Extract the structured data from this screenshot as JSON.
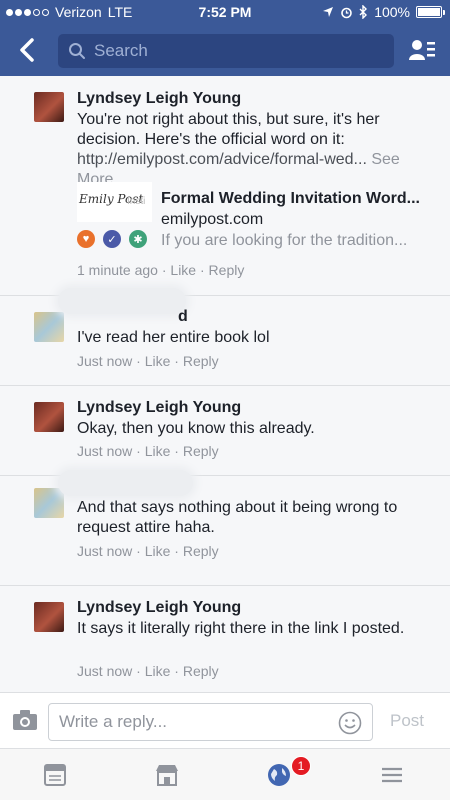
{
  "status_bar": {
    "carrier": "Verizon",
    "network": "LTE",
    "time": "7:52 PM",
    "battery": "100%"
  },
  "nav": {
    "search_placeholder": "Search"
  },
  "comments": [
    {
      "author": "Lyndsey Leigh Young",
      "text_plain": "You're not right about this, but sure, it's her decision. Here's the official word on it: ",
      "link_text": "http://emilypost.com/advice/formal-wed...",
      "see_more": "See More",
      "meta_time": "1 minute ago",
      "like": "Like",
      "reply": "Reply",
      "link_preview": {
        "thumb_script": "Emily Post",
        "thumb_text": "Insti",
        "title": "Formal Wedding Invitation Word...",
        "domain": "emilypost.com",
        "description": "If you are looking for the tradition..."
      }
    },
    {
      "author_visible": "d",
      "text": "I've read her entire book lol",
      "meta_time": "Just now",
      "like": "Like",
      "reply": "Reply"
    },
    {
      "author": "Lyndsey Leigh Young",
      "text": "Okay, then you know this already.",
      "meta_time": "Just now",
      "like": "Like",
      "reply": "Reply"
    },
    {
      "text": "And that says nothing about it being wrong to request attire haha.",
      "meta_time": "Just now",
      "like": "Like",
      "reply": "Reply"
    },
    {
      "author": "Lyndsey Leigh Young",
      "text": "It says it literally right there in the link I posted.",
      "meta_time": "Just now",
      "like": "Like",
      "reply": "Reply"
    }
  ],
  "reply_bar": {
    "placeholder": "Write a reply...",
    "post_label": "Post"
  },
  "tab_bar": {
    "notification_count": "1"
  },
  "colors": {
    "brand": "#3b5998",
    "badge": "#e41b23"
  }
}
